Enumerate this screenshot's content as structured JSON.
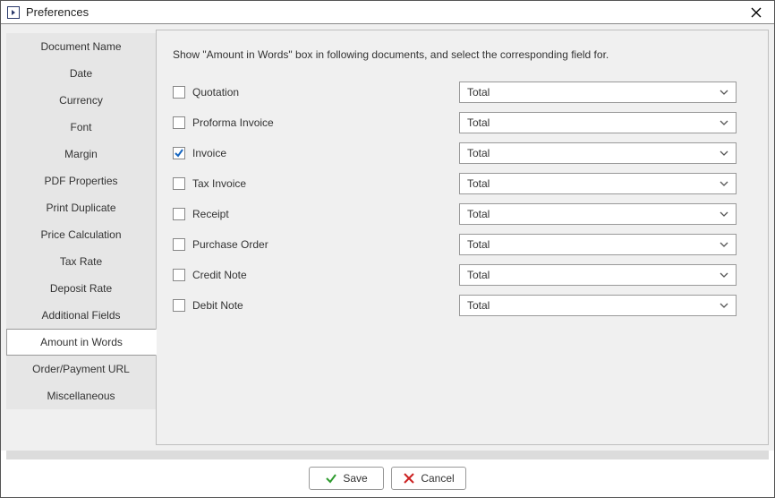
{
  "window": {
    "title": "Preferences"
  },
  "tabs": [
    {
      "label": "Document Name",
      "active": false
    },
    {
      "label": "Date",
      "active": false
    },
    {
      "label": "Currency",
      "active": false
    },
    {
      "label": "Font",
      "active": false
    },
    {
      "label": "Margin",
      "active": false
    },
    {
      "label": "PDF Properties",
      "active": false
    },
    {
      "label": "Print Duplicate",
      "active": false
    },
    {
      "label": "Price Calculation",
      "active": false
    },
    {
      "label": "Tax Rate",
      "active": false
    },
    {
      "label": "Deposit Rate",
      "active": false
    },
    {
      "label": "Additional Fields",
      "active": false
    },
    {
      "label": "Amount in Words",
      "active": true
    },
    {
      "label": "Order/Payment URL",
      "active": false
    },
    {
      "label": "Miscellaneous",
      "active": false
    }
  ],
  "content": {
    "description": "Show \"Amount in Words\" box in following documents, and select the corresponding field for.",
    "rows": [
      {
        "label": "Quotation",
        "checked": false,
        "field": "Total"
      },
      {
        "label": "Proforma Invoice",
        "checked": false,
        "field": "Total"
      },
      {
        "label": "Invoice",
        "checked": true,
        "field": "Total"
      },
      {
        "label": "Tax Invoice",
        "checked": false,
        "field": "Total"
      },
      {
        "label": "Receipt",
        "checked": false,
        "field": "Total"
      },
      {
        "label": "Purchase Order",
        "checked": false,
        "field": "Total"
      },
      {
        "label": "Credit Note",
        "checked": false,
        "field": "Total"
      },
      {
        "label": "Debit Note",
        "checked": false,
        "field": "Total"
      }
    ]
  },
  "footer": {
    "save": "Save",
    "cancel": "Cancel"
  }
}
